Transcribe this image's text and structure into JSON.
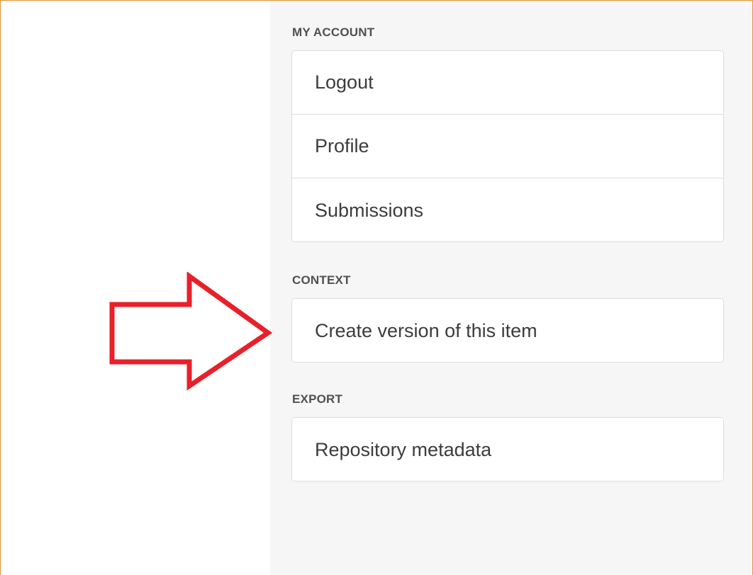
{
  "sections": [
    {
      "header": "MY ACCOUNT",
      "items": [
        {
          "label": "Logout"
        },
        {
          "label": "Profile"
        },
        {
          "label": "Submissions"
        }
      ]
    },
    {
      "header": "CONTEXT",
      "items": [
        {
          "label": "Create version of this item"
        }
      ]
    },
    {
      "header": "EXPORT",
      "items": [
        {
          "label": "Repository metadata"
        }
      ]
    }
  ],
  "annotation": {
    "arrow_color": "#e8202a",
    "icon": "right-arrow-icon"
  },
  "colors": {
    "frame_border": "#e2962f",
    "sidebar_bg": "#f6f6f6",
    "item_border": "#dcdcdc",
    "header_text": "#505050",
    "item_text": "#3c3c3c"
  }
}
